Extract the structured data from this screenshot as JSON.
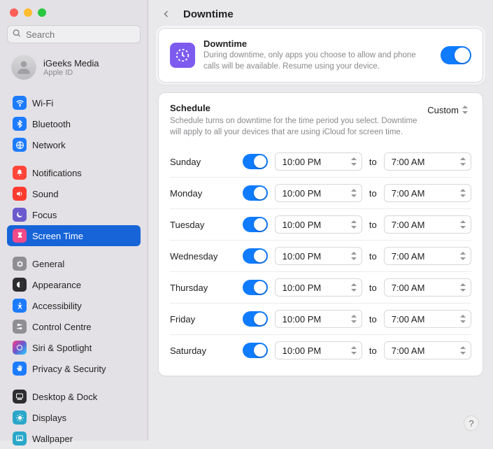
{
  "search": {
    "placeholder": "Search"
  },
  "profile": {
    "name": "iGeeks Media",
    "sub": "Apple ID"
  },
  "sidebar": {
    "groups": [
      {
        "items": [
          {
            "label": "Wi-Fi",
            "icon": "wifi",
            "cls": "ic-blue"
          },
          {
            "label": "Bluetooth",
            "icon": "bluetooth",
            "cls": "ic-blue"
          },
          {
            "label": "Network",
            "icon": "network",
            "cls": "ic-blue"
          }
        ]
      },
      {
        "items": [
          {
            "label": "Notifications",
            "icon": "bell",
            "cls": "ic-red"
          },
          {
            "label": "Sound",
            "icon": "sound",
            "cls": "ic-red2"
          },
          {
            "label": "Focus",
            "icon": "moon",
            "cls": "ic-purple"
          },
          {
            "label": "Screen Time",
            "icon": "hourglass",
            "cls": "ic-pink",
            "selected": true
          }
        ]
      },
      {
        "items": [
          {
            "label": "General",
            "icon": "gear",
            "cls": "ic-gray"
          },
          {
            "label": "Appearance",
            "icon": "appearance",
            "cls": "ic-black"
          },
          {
            "label": "Accessibility",
            "icon": "access",
            "cls": "ic-blue2"
          },
          {
            "label": "Control Centre",
            "icon": "controls",
            "cls": "ic-gray"
          },
          {
            "label": "Siri & Spotlight",
            "icon": "siri",
            "cls": "ic-grad"
          },
          {
            "label": "Privacy & Security",
            "icon": "hand",
            "cls": "ic-blue2"
          }
        ]
      },
      {
        "items": [
          {
            "label": "Desktop & Dock",
            "icon": "dock",
            "cls": "ic-black"
          },
          {
            "label": "Displays",
            "icon": "display",
            "cls": "ic-teal"
          },
          {
            "label": "Wallpaper",
            "icon": "wallpaper",
            "cls": "ic-teal"
          }
        ]
      }
    ]
  },
  "page": {
    "title": "Downtime",
    "hero": {
      "title": "Downtime",
      "desc": "During downtime, only apps you choose to allow and phone calls will be available. Resume using your device."
    },
    "schedule": {
      "title": "Schedule",
      "desc": "Schedule turns on downtime for the time period you select. Downtime will apply to all your devices that are using iCloud for screen time.",
      "mode": "Custom",
      "to_label": "to",
      "days": [
        {
          "name": "Sunday",
          "on": true,
          "from": "10:00 PM",
          "to": "7:00 AM"
        },
        {
          "name": "Monday",
          "on": true,
          "from": "10:00 PM",
          "to": "7:00 AM"
        },
        {
          "name": "Tuesday",
          "on": true,
          "from": "10:00 PM",
          "to": "7:00 AM"
        },
        {
          "name": "Wednesday",
          "on": true,
          "from": "10:00 PM",
          "to": "7:00 AM"
        },
        {
          "name": "Thursday",
          "on": true,
          "from": "10:00 PM",
          "to": "7:00 AM"
        },
        {
          "name": "Friday",
          "on": true,
          "from": "10:00 PM",
          "to": "7:00 AM"
        },
        {
          "name": "Saturday",
          "on": true,
          "from": "10:00 PM",
          "to": "7:00 AM"
        }
      ]
    }
  },
  "help": "?"
}
